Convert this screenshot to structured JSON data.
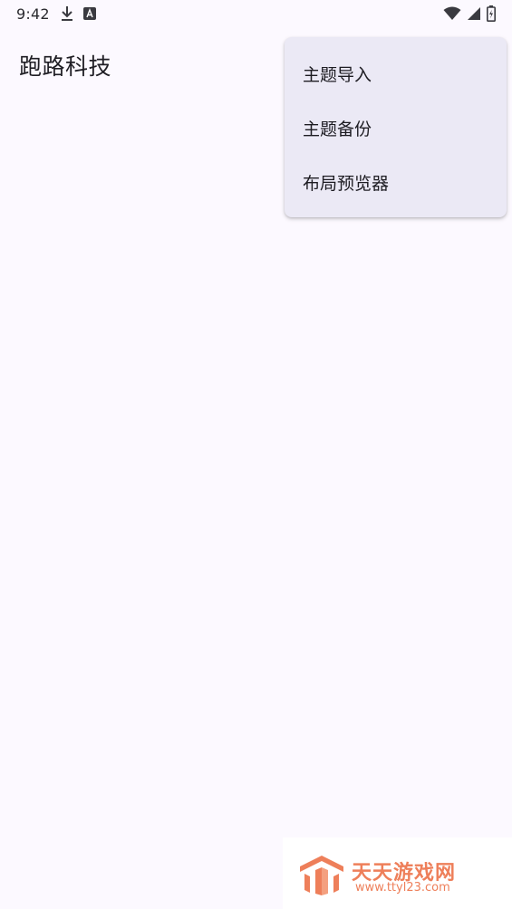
{
  "status_bar": {
    "time": "9:42",
    "icons": [
      "download-icon",
      "a-badge-icon",
      "wifi-icon",
      "cell-signal-icon",
      "battery-charging-icon"
    ]
  },
  "app": {
    "title": "跑路科技"
  },
  "overflow_menu": {
    "items": [
      {
        "label": "主题导入"
      },
      {
        "label": "主题备份"
      },
      {
        "label": "布局预览器"
      }
    ]
  },
  "watermark": {
    "brand": "天天游戏网",
    "url": "www.ttyl23.com",
    "color": "#ee7f5a"
  },
  "colors": {
    "background": "#fcf9ff",
    "menu_background": "#ebe9f5"
  }
}
